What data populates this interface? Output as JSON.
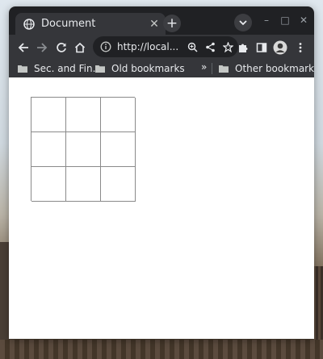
{
  "tab": {
    "title": "Document",
    "close_glyph": "✕"
  },
  "new_tab_glyph": "+",
  "window_controls": {
    "minimize": "–",
    "maximize": "□",
    "close": "✕"
  },
  "omnibox": {
    "url": "http://local..."
  },
  "bookmarks": {
    "items": [
      {
        "label": "Sec. and Fin."
      },
      {
        "label": "Old bookmarks"
      }
    ],
    "more_glyph": "»",
    "other": "Other bookmarks"
  },
  "board": {
    "cells": [
      "",
      "",
      "",
      "",
      "",
      "",
      "",
      "",
      ""
    ]
  }
}
